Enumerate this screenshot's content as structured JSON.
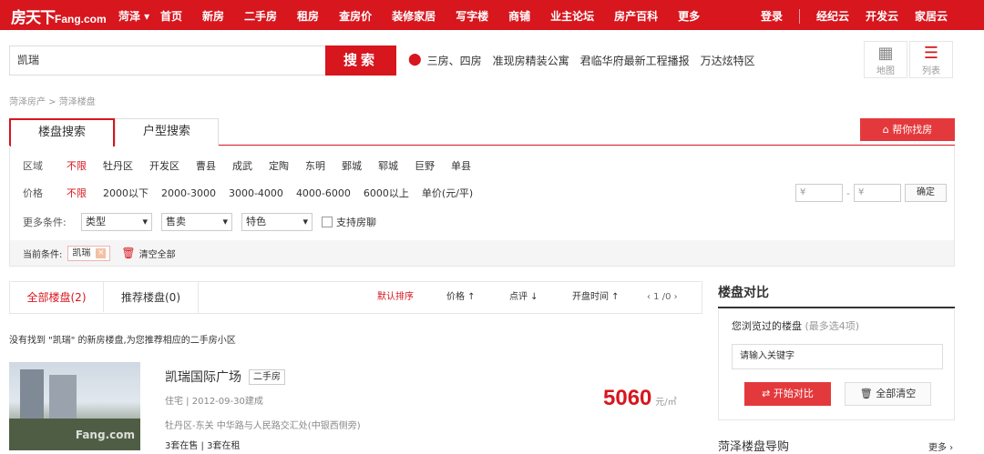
{
  "header": {
    "logo_cn": "房天下",
    "logo_en": "Fang.com",
    "city": "菏泽 ▾",
    "nav": [
      "首页",
      "新房",
      "二手房",
      "租房",
      "查房价",
      "装修家居",
      "写字楼",
      "商铺",
      "业主论坛",
      "房产百科",
      "更多"
    ],
    "right_nav": [
      "登录",
      "经纪云",
      "开发云",
      "家居云"
    ]
  },
  "search": {
    "value": "凯瑞",
    "button": "搜索",
    "hot": [
      "三房、四房",
      "准现房精装公寓",
      "君临华府最新工程播报",
      "万达炫特区"
    ],
    "map_label": "地图",
    "list_label": "列表"
  },
  "breadcrumb": "菏泽房产 > 菏泽楼盘",
  "tabs": {
    "t1": "楼盘搜索",
    "t2": "户型搜索",
    "help": "帮你找房"
  },
  "filter": {
    "area_label": "区域",
    "areas": [
      "不限",
      "牡丹区",
      "开发区",
      "曹县",
      "成武",
      "定陶",
      "东明",
      "鄄城",
      "郓城",
      "巨野",
      "单县"
    ],
    "price_label": "价格",
    "prices": [
      "不限",
      "2000以下",
      "2000-3000",
      "3000-4000",
      "4000-6000",
      "6000以上",
      "单价(元/平)"
    ],
    "price_min": "¥",
    "price_max": "¥",
    "price_dash": "-",
    "confirm": "确定",
    "more_label": "更多条件:",
    "selects": [
      "类型",
      "售卖",
      "特色"
    ],
    "checkbox": "支持房聊",
    "current_label": "当前条件:",
    "current_tag": "凯瑞",
    "tag_close": "×",
    "clear_all": "清空全部"
  },
  "listing": {
    "tab_all": "全部楼盘(2)",
    "tab_rec": "推荐楼盘(0)",
    "sort_default": "默认排序",
    "sort_price": "价格 ↑",
    "sort_score": "点评 ↓",
    "sort_open": "开盘时间 ↑",
    "pager": "‹  1 /0  ›",
    "note": "没有找到 \"凯瑞\" 的新房楼盘,为您推荐相应的二手房小区",
    "watermark": "Fang.com",
    "item": {
      "name": "凯瑞国际广场",
      "tag": "二手房",
      "type": "住宅 | 2012-09-30建成",
      "address": "牡丹区-东关 中华路与人民路交汇处(中银西侧旁)",
      "counts": "3套在售 | 3套在租",
      "price": "5060",
      "unit": "元/㎡"
    }
  },
  "compare": {
    "title": "楼盘对比",
    "sub": "您浏览过的楼盘",
    "sub_hint": "(最多选4项)",
    "input_placeholder": "请输入关键字",
    "start": "⇄ 开始对比",
    "clear": "🗑 全部清空"
  },
  "guide": {
    "title": "菏泽楼盘导购",
    "more": "更多 ›"
  }
}
